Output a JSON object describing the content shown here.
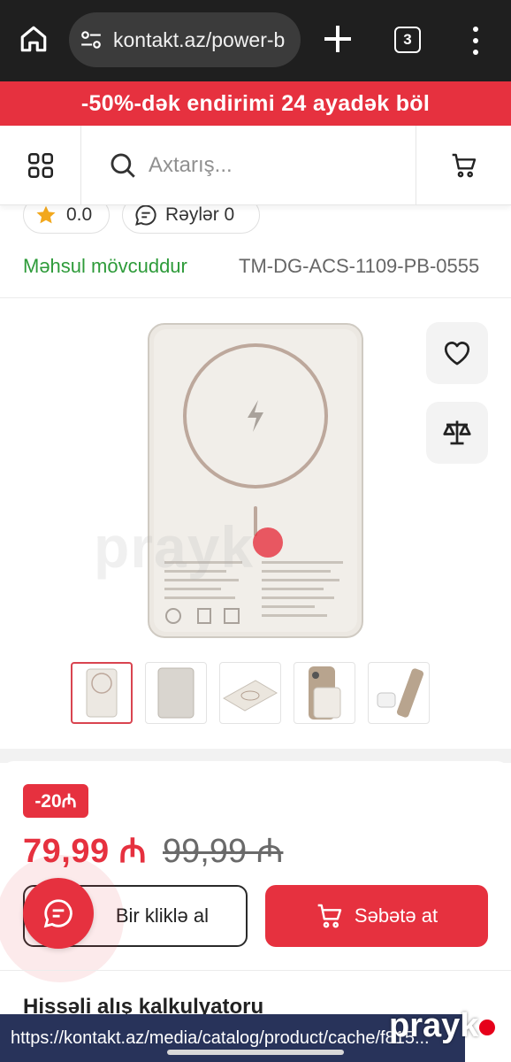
{
  "browser": {
    "url": "kontakt.az/power-b",
    "tab_count": "3"
  },
  "promo": {
    "text": "-50%-dək endirimi 24 ayadək böl"
  },
  "header": {
    "search_placeholder": "Axtarış..."
  },
  "product": {
    "rating": "0.0",
    "reviews_label": "Rəylər 0",
    "availability": "Məhsul mövcuddur",
    "sku": "TM-DG-ACS-1109-PB-0555",
    "thumbnail_count": 5,
    "active_thumbnail": 1
  },
  "pricing": {
    "discount_badge": "-20₼",
    "price_now": "79,99 ₼",
    "price_old": "99,99 ₼",
    "one_click_label": "Bir kliklə al",
    "add_to_cart_label": "Səbətə at"
  },
  "installment": {
    "title": "Hissəli alış kalkulyatoru"
  },
  "link_preview": {
    "url": "https://kontakt.az/media/catalog/product/cache/f815..."
  },
  "watermark": {
    "text": "prayk"
  },
  "colors": {
    "brand_red": "#e6313f",
    "available_green": "#2e9b3a",
    "chrome_dark": "#1f1f1f"
  }
}
